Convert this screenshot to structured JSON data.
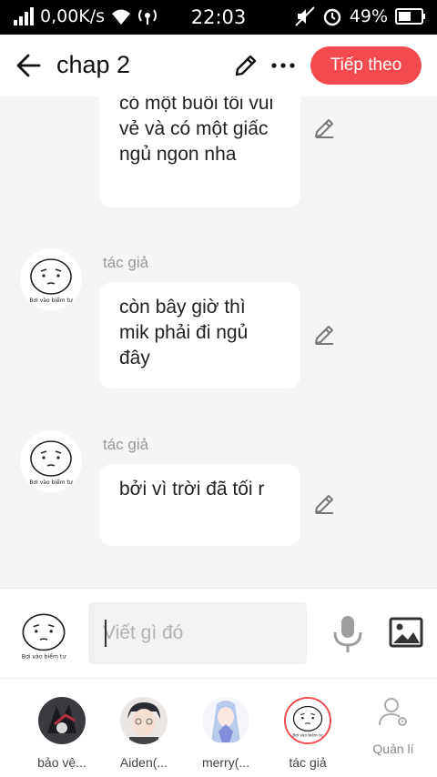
{
  "status_bar": {
    "network_speed": "0,00K/s",
    "time": "22:03",
    "battery": "49%"
  },
  "header": {
    "title": "chap 2",
    "next_label": "Tiếp theo"
  },
  "messages": [
    {
      "sender": "",
      "text": "có một buổi tối vui vẻ và có một giấc ngủ ngon nha"
    },
    {
      "sender": "tác giả",
      "text": "còn bây giờ thì mik phải đi ngủ đây"
    },
    {
      "sender": "tác giả",
      "text": "bởi vì trời đã tối r"
    }
  ],
  "avatar_caption": "Bơi vào biểm tư",
  "input": {
    "placeholder": "Viết gì đó",
    "value": ""
  },
  "characters": [
    {
      "name": "bảo vệ...",
      "selected": false
    },
    {
      "name": "Aiden(...",
      "selected": false
    },
    {
      "name": "merry(...",
      "selected": false
    },
    {
      "name": "tác giả",
      "selected": true
    }
  ],
  "manage_label": "Quản lí",
  "colors": {
    "accent": "#f44a4f",
    "background": "#f5f5f5"
  }
}
